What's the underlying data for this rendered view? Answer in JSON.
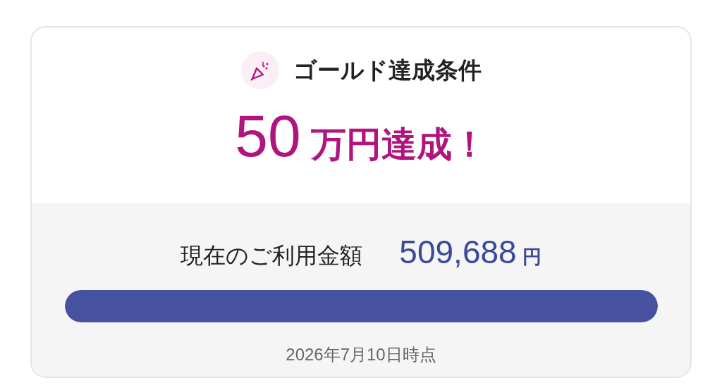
{
  "header": {
    "title": "ゴールド達成条件"
  },
  "goal": {
    "amount": "50",
    "suffix": "万円達成！"
  },
  "usage": {
    "label": "現在のご利用金額",
    "amount": "509,688",
    "unit": "円",
    "level": 1
  },
  "as_of": "2026年7月10日時点"
}
